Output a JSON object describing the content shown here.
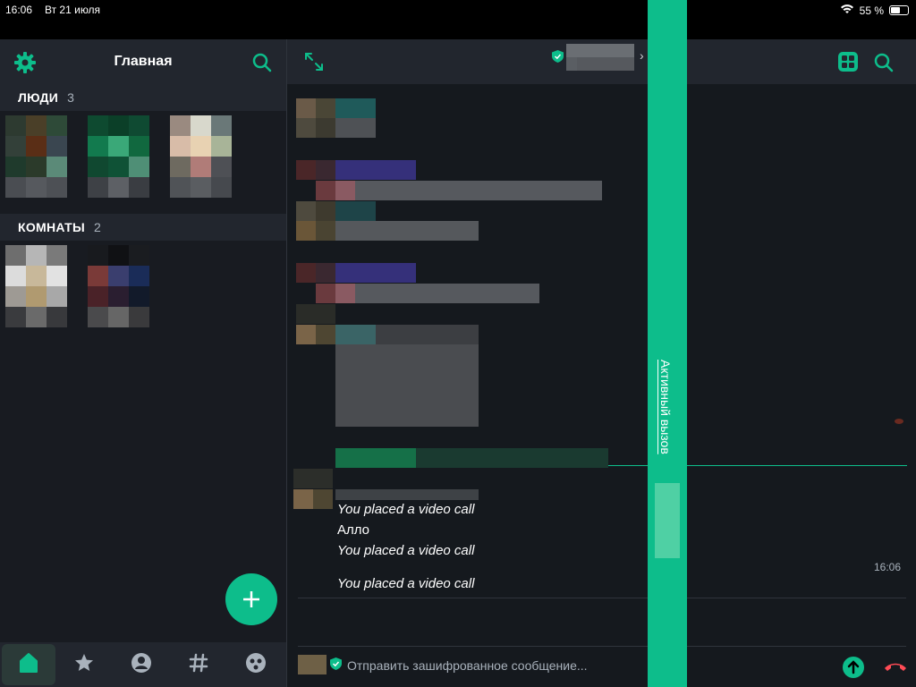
{
  "status_bar": {
    "time": "16:06",
    "date": "Вт 21 июля",
    "battery": "55 %",
    "battery_level": 0.55,
    "wifi_icon": "wifi-icon"
  },
  "sidebar": {
    "title": "Главная",
    "people": {
      "label": "ЛЮДИ",
      "count": "3"
    },
    "rooms": {
      "label": "КОМНАТЫ",
      "count": "2"
    }
  },
  "tabbar": {
    "items": [
      "home-icon",
      "star-icon",
      "person-icon",
      "hash-icon",
      "explore-icon"
    ],
    "active": "home"
  },
  "timeline": {
    "messages": [
      {
        "text": "You placed a video call",
        "italic": true
      },
      {
        "text": "Алло",
        "italic": false
      },
      {
        "text": "You placed a video call",
        "italic": true
      },
      {
        "text": "You placed a video call",
        "italic": true
      }
    ],
    "timestamp": "16:06"
  },
  "composer": {
    "placeholder": "Отправить зашифрованное сообщение..."
  },
  "active_call": {
    "label": "Активный вызов"
  },
  "colors": {
    "accent": "#0dbd8b",
    "background": "#15191e",
    "panel": "#22262e",
    "hangup": "#ff4b55"
  }
}
